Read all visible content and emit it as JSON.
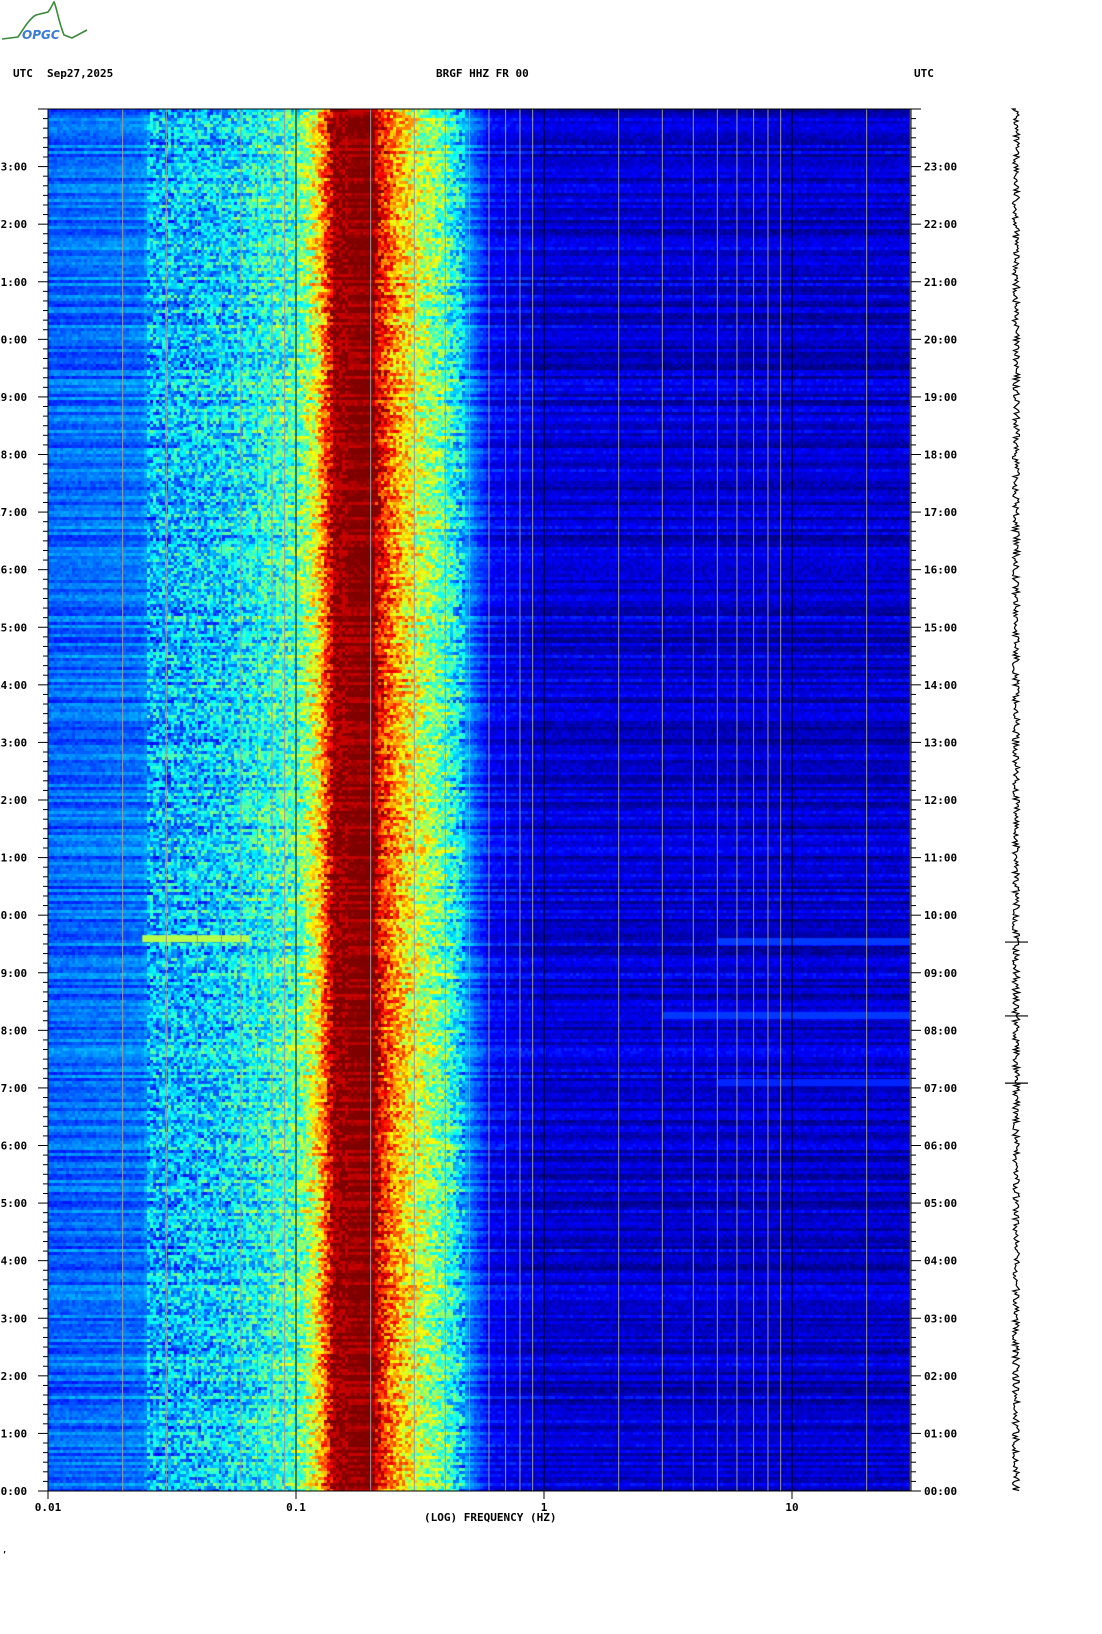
{
  "header": {
    "logo_text": "OPGC",
    "left_tz": "UTC",
    "date": "Sep27,2025",
    "station": "BRGF HHZ FR 00",
    "right_tz": "UTC"
  },
  "footer_mark": "ʼ",
  "chart_data": {
    "type": "heatmap",
    "title": "BRGF HHZ FR 00",
    "xlabel": "(LOG) FREQUENCY (HZ)",
    "ylabel": "UTC",
    "xscale": "log",
    "xlim": [
      0.01,
      30
    ],
    "ylim_hours": [
      0,
      24
    ],
    "x_tick_labels": [
      "0.01",
      "0.1",
      "1",
      "10"
    ],
    "x_ticks": [
      0.01,
      0.1,
      1,
      10
    ],
    "y_tick_labels": [
      "00:00",
      "01:00",
      "02:00",
      "03:00",
      "04:00",
      "05:00",
      "06:00",
      "07:00",
      "08:00",
      "09:00",
      "10:00",
      "11:00",
      "12:00",
      "13:00",
      "14:00",
      "15:00",
      "16:00",
      "17:00",
      "18:00",
      "19:00",
      "20:00",
      "21:00",
      "22:00",
      "23:00"
    ],
    "colormap": "jet",
    "grid": true,
    "intensity_profile": {
      "freq_hz": [
        0.01,
        0.024,
        0.025,
        0.05,
        0.1,
        0.12,
        0.14,
        0.2,
        0.22,
        0.25,
        0.3,
        0.4,
        0.5,
        0.6,
        1,
        30
      ],
      "level": [
        0.22,
        0.24,
        0.3,
        0.33,
        0.45,
        0.62,
        0.97,
        1.0,
        0.85,
        0.72,
        0.58,
        0.45,
        0.25,
        0.12,
        0.08,
        0.07
      ]
    },
    "events": [
      {
        "time": "09:35",
        "freq_range_hz": [
          0.024,
          0.065
        ],
        "level": 0.55
      },
      {
        "time": "09:32",
        "freq_range_hz": [
          5,
          30
        ],
        "level": 0.18
      },
      {
        "time": "08:15",
        "freq_range_hz": [
          3,
          30
        ],
        "level": 0.18
      },
      {
        "time": "07:05",
        "freq_range_hz": [
          5,
          30
        ],
        "level": 0.16
      }
    ]
  }
}
